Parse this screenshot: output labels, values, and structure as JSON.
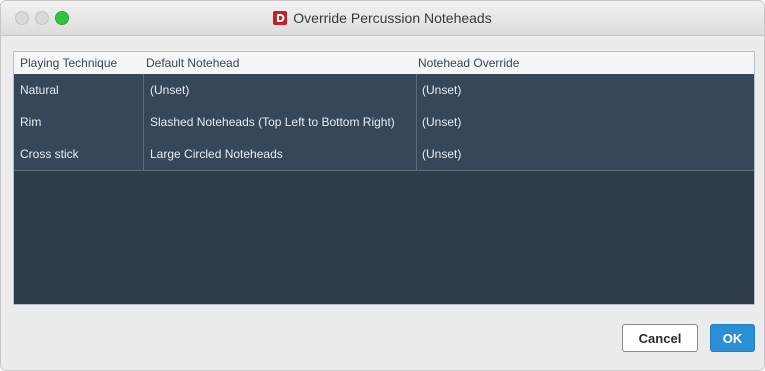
{
  "window": {
    "title": "Override Percussion Noteheads"
  },
  "table": {
    "columns": [
      "Playing Technique",
      "Default Notehead",
      "Notehead Override"
    ],
    "rows": [
      {
        "technique": "Natural",
        "default": "(Unset)",
        "override": "(Unset)"
      },
      {
        "technique": "Rim",
        "default": "Slashed Noteheads (Top Left to Bottom Right)",
        "override": "(Unset)"
      },
      {
        "technique": "Cross stick",
        "default": "Large Circled Noteheads",
        "override": "(Unset)"
      }
    ]
  },
  "buttons": {
    "cancel": "Cancel",
    "ok": "OK"
  },
  "colors": {
    "accent": "#2b8fd6",
    "table_bg": "#2f3d4a",
    "logo": "#c4202b"
  }
}
